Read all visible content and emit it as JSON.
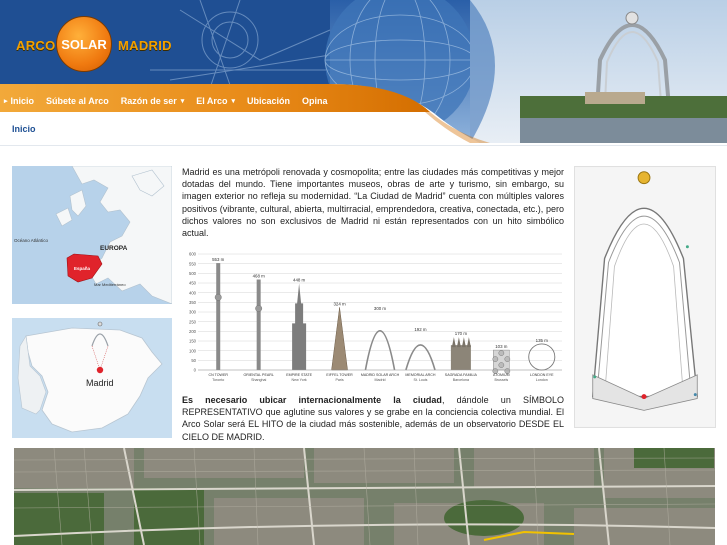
{
  "logo": {
    "word1": "ARCO",
    "word2": "SOLAR",
    "word3": "MADRID"
  },
  "nav": {
    "items": [
      {
        "label": "Inicio",
        "bullet": true,
        "caret": false
      },
      {
        "label": "Súbete al Arco",
        "bullet": false,
        "caret": false
      },
      {
        "label": "Razón de ser",
        "bullet": false,
        "caret": true
      },
      {
        "label": "El Arco",
        "bullet": false,
        "caret": true
      },
      {
        "label": "Ubicación",
        "bullet": false,
        "caret": false
      },
      {
        "label": "Opina",
        "bullet": false,
        "caret": false
      }
    ]
  },
  "breadcrumb": "Inicio",
  "maps": {
    "europe": {
      "ocean": "Océano Atlántico",
      "europe": "EUROPA",
      "spain": "España",
      "sea": "Mar Mediterráneo"
    },
    "spain": {
      "city": "Madrid"
    }
  },
  "intro": "Madrid es una metrópoli renovada y cosmopolita; entre las ciudades más competitivas y mejor dotadas del mundo. Tiene importantes museos, obras de arte y turismo, sin embargo, su imagen exterior no refleja su modernidad. “La Ciudad de Madrid” cuenta con múltiples valores positivos (vibrante, cultural, abierta, multirracial, emprendedora, creativa, conectada, etc.), pero dichos valores no son exclusivos de Madrid ni están representados con un hito simbólico actual.",
  "outro": {
    "bold": "Es necesario ubicar internacionalmente la ciudad",
    "rest": ", dándole un SÍMBOLO REPRESENTATIVO que aglutine sus valores y se grabe en la conciencia colectiva mundial. El Arco Solar será EL HITO de la ciudad más sostenible, además de un observatorio DESDE EL CIELO DE MADRID."
  },
  "chart_data": {
    "type": "bar",
    "ylim": [
      0,
      600
    ],
    "ticks": [
      0,
      50,
      100,
      150,
      200,
      250,
      300,
      350,
      400,
      450,
      500,
      550,
      600
    ],
    "categories": [
      {
        "name": "CN TOWER",
        "city": "Toronto",
        "value": 553,
        "label": "553 m"
      },
      {
        "name": "ORIENTAL PEARL",
        "city": "Shanghai",
        "value": 468,
        "label": "468 m"
      },
      {
        "name": "EMPIRE STATE",
        "city": "New York",
        "value": 448,
        "label": "448 m"
      },
      {
        "name": "EIFFEL TOWER",
        "city": "Paris",
        "value": 324,
        "label": "324 m"
      },
      {
        "name": "MADRID SOLAR ARCH",
        "city": "Madrid",
        "value": 300,
        "label": "300 m"
      },
      {
        "name": "MEMORIAL ARCH",
        "city": "St. Louis",
        "value": 192,
        "label": "192 m"
      },
      {
        "name": "SAGRADA FAMILIA",
        "city": "Barcelona",
        "value": 170,
        "label": "170 m"
      },
      {
        "name": "ATOMIUM",
        "city": "Brussels",
        "value": 103,
        "label": "103 m"
      },
      {
        "name": "LONDON EYE",
        "city": "London",
        "value": 135,
        "label": "135 m"
      }
    ]
  }
}
